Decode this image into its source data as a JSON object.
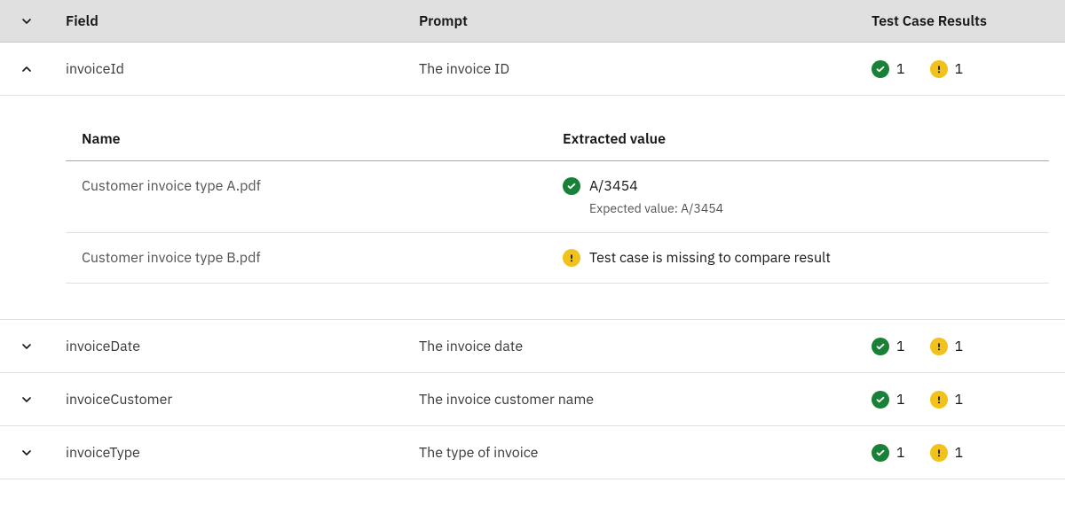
{
  "table": {
    "headers": {
      "field": "Field",
      "prompt": "Prompt",
      "results": "Test Case Results"
    },
    "rows": [
      {
        "expanded": true,
        "field": "invoiceId",
        "prompt": "The invoice ID",
        "results": {
          "success": "1",
          "warning": "1"
        },
        "detail": {
          "headers": {
            "name": "Name",
            "value": "Extracted value"
          },
          "items": [
            {
              "name": "Customer invoice type A.pdf",
              "status": "success",
              "value": "A/3454",
              "expected": "Expected value: A/3454"
            },
            {
              "name": "Customer invoice type B.pdf",
              "status": "warning",
              "message": "Test case is missing to compare result"
            }
          ]
        }
      },
      {
        "expanded": false,
        "field": "invoiceDate",
        "prompt": "The invoice date",
        "results": {
          "success": "1",
          "warning": "1"
        }
      },
      {
        "expanded": false,
        "field": "invoiceCustomer",
        "prompt": "The invoice customer name",
        "results": {
          "success": "1",
          "warning": "1"
        }
      },
      {
        "expanded": false,
        "field": "invoiceType",
        "prompt": "The type of invoice",
        "results": {
          "success": "1",
          "warning": "1"
        }
      }
    ]
  }
}
